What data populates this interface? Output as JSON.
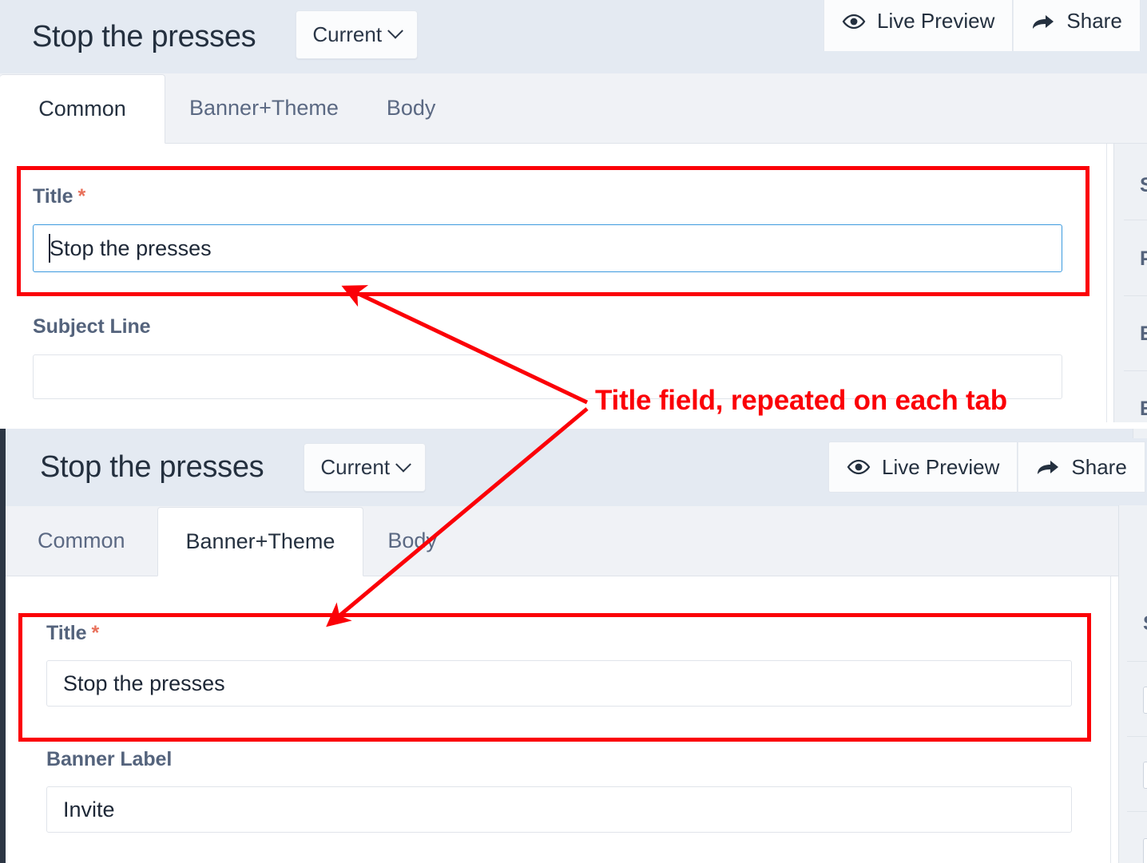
{
  "annotation": {
    "label": "Title field, repeated on each tab",
    "color": "#fb0007"
  },
  "screenshot_one": {
    "header": {
      "title": "Stop the presses",
      "version_selector": {
        "label": "Current",
        "icon": "chevron-down-icon"
      },
      "actions": [
        {
          "label": "Live Preview",
          "icon": "eye-icon"
        },
        {
          "label": "Share",
          "icon": "share-arrow-icon"
        }
      ]
    },
    "tabs": [
      {
        "label": "Common",
        "active": true
      },
      {
        "label": "Banner+Theme",
        "active": false
      },
      {
        "label": "Body",
        "active": false
      }
    ],
    "fields": [
      {
        "label": "Title",
        "required_marker": "*",
        "value": "Stop the presses",
        "focused": true,
        "highlighted": true
      },
      {
        "label": "Subject Line",
        "required_marker": "",
        "value": "",
        "focused": false,
        "highlighted": false
      }
    ],
    "sidebar_fragments": [
      "S",
      "P",
      "E",
      "E"
    ]
  },
  "screenshot_two": {
    "header": {
      "title": "Stop the presses",
      "version_selector": {
        "label": "Current",
        "icon": "chevron-down-icon"
      },
      "actions": [
        {
          "label": "Live Preview",
          "icon": "eye-icon"
        },
        {
          "label": "Share",
          "icon": "share-arrow-icon"
        }
      ]
    },
    "tabs": [
      {
        "label": "Common",
        "active": false
      },
      {
        "label": "Banner+Theme",
        "active": true
      },
      {
        "label": "Body",
        "active": false
      }
    ],
    "fields": [
      {
        "label": "Title",
        "required_marker": "*",
        "value": "Stop the presses",
        "focused": false,
        "highlighted": true
      },
      {
        "label": "Banner Label",
        "required_marker": "",
        "value": "Invite",
        "focused": false,
        "highlighted": false
      }
    ],
    "sidebar_fragments": [
      "S",
      "",
      "",
      ""
    ]
  },
  "colors": {
    "header_bg": "#e4eaf2",
    "tabbar_bg": "#f0f2f6",
    "label_text": "#54637c",
    "title_text": "#24303f",
    "focus_border": "#3c9ade",
    "required_star": "#e8705a",
    "dark_edge": "#2c3644",
    "sidepanel_bg": "#eef1f5"
  }
}
